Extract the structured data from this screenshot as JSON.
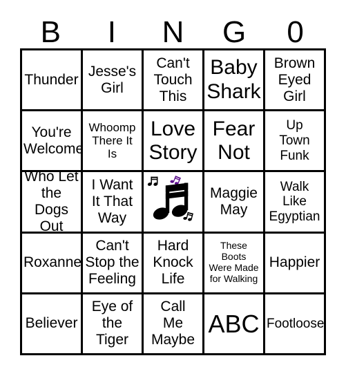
{
  "card": {
    "header": {
      "letters": [
        "B",
        "I",
        "N",
        "G",
        "0"
      ]
    },
    "rows": [
      [
        {
          "text": "Thunder",
          "size": "lg"
        },
        {
          "text": "Jesse's\nGirl",
          "size": "lg"
        },
        {
          "text": "Can't\nTouch\nThis",
          "size": "lg"
        },
        {
          "text": "Baby\nShark",
          "size": "xl"
        },
        {
          "text": "Brown\nEyed\nGirl",
          "size": "lg"
        }
      ],
      [
        {
          "text": "You're\nWelcome",
          "size": "lg"
        },
        {
          "text": "Whoomp\nThere It\nIs",
          "size": "sm"
        },
        {
          "text": "Love\nStory",
          "size": "xl"
        },
        {
          "text": "Fear\nNot",
          "size": "xl"
        },
        {
          "text": "Up\nTown\nFunk",
          "size": "md"
        }
      ],
      [
        {
          "text": "Who Let\nthe Dogs\nOut",
          "size": "lg"
        },
        {
          "text": "I Want\nIt That\nWay",
          "size": "lg"
        },
        {
          "text": "",
          "size": "lg",
          "free_space": true,
          "icon": "music-notes"
        },
        {
          "text": "Maggie\nMay",
          "size": "lg"
        },
        {
          "text": "Walk\nLike\nEgyptian",
          "size": "md"
        }
      ],
      [
        {
          "text": "Roxanne",
          "size": "lg"
        },
        {
          "text": "Can't\nStop the\nFeeling",
          "size": "lg"
        },
        {
          "text": "Hard\nKnock\nLife",
          "size": "lg"
        },
        {
          "text": "These\nBoots\nWere Made\nfor Walking",
          "size": "xs"
        },
        {
          "text": "Happier",
          "size": "lg"
        }
      ],
      [
        {
          "text": "Believer",
          "size": "lg"
        },
        {
          "text": "Eye of\nthe\nTiger",
          "size": "lg"
        },
        {
          "text": "Call\nMe\nMaybe",
          "size": "lg"
        },
        {
          "text": "ABC",
          "size": "abc"
        },
        {
          "text": "Footloose",
          "size": "md"
        }
      ]
    ],
    "colors": {
      "grid_line": "#000000",
      "text": "#000000",
      "background": "#ffffff",
      "accent_note": "#5B0F8B"
    }
  }
}
